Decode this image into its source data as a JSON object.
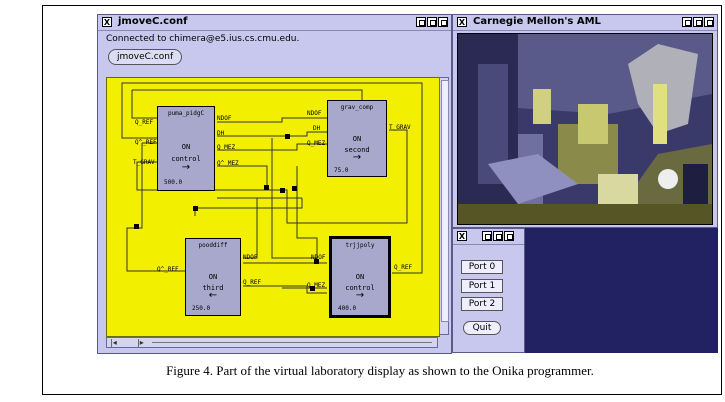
{
  "main_window": {
    "title": "jmoveC.conf",
    "status": "Connected to chimera@e5.ius.cs.cmu.edu.",
    "file_button": "jmoveC.conf"
  },
  "modules": {
    "puma": {
      "name": "puma_pidgC",
      "state": "ON",
      "role": "control",
      "arrow": "→",
      "freq": "500.0",
      "inputs": [
        "Q_REF",
        "Q^_REF",
        "T_GRAV"
      ],
      "outputs": [
        "NDOF",
        "DH",
        "Q_MEZ",
        "Q^_MEZ"
      ]
    },
    "grav": {
      "name": "grav_comp",
      "state": "ON",
      "role": "second",
      "arrow": "→",
      "freq": "75.0",
      "inputs": [
        "NDOF",
        "DH",
        "Q_MEZ"
      ],
      "outputs": [
        "T_GRAV"
      ]
    },
    "pood": {
      "name": "pooddiff",
      "state": "ON",
      "role": "third",
      "arrow": "←",
      "freq": "250.0",
      "inputs": [
        "Q^_REF"
      ],
      "outputs": [
        "NDOF",
        "Q_REF"
      ]
    },
    "traj": {
      "name": "trjjpoly",
      "state": "ON",
      "role": "control",
      "arrow": "→",
      "freq": "400.0",
      "inputs": [
        "NDOF",
        "Q_MEZ"
      ],
      "outputs": [
        "Q_REF"
      ]
    }
  },
  "camera_window": {
    "title": "Carnegie Mellon's AML"
  },
  "port_panel": {
    "buttons": [
      "Port 0",
      "Port 1",
      "Port 2"
    ],
    "quit": "Quit"
  },
  "caption": "Figure 4. Part of the virtual laboratory display as shown to the Onika programmer.",
  "colors": {
    "canvas": "#f2f000",
    "window": "#c8c8ee",
    "module": "#a8a8cc",
    "dark_panel": "#222262"
  }
}
